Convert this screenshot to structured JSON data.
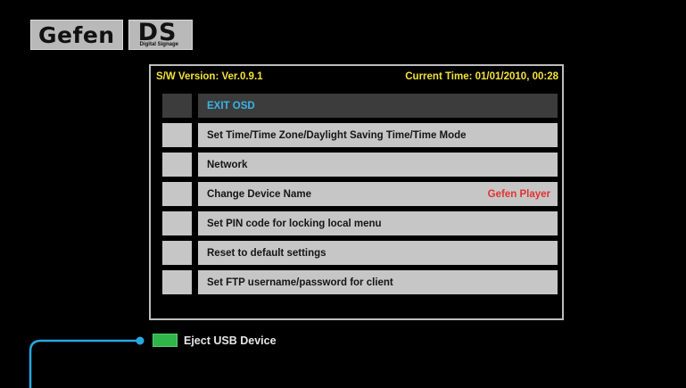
{
  "logo": {
    "brand": "Gefen",
    "product": "DS",
    "tagline": "Digital Signage"
  },
  "header": {
    "version": "S/W Version: Ver.0.9.1",
    "current_time": "Current Time: 01/01/2010, 00:28"
  },
  "menu": {
    "items": [
      {
        "label": "EXIT OSD",
        "value": "",
        "selected": true
      },
      {
        "label": "Set Time/Time Zone/Daylight Saving Time/Time Mode",
        "value": ""
      },
      {
        "label": "Network",
        "value": ""
      },
      {
        "label": "Change Device Name",
        "value": "Gefen Player"
      },
      {
        "label": "Set PIN code for locking local menu",
        "value": ""
      },
      {
        "label": "Reset to default settings",
        "value": ""
      },
      {
        "label": "Set FTP username/password for client",
        "value": ""
      }
    ]
  },
  "footer": {
    "eject_label": "Eject USB Device"
  },
  "colors": {
    "background": "#000000",
    "header_text": "#f2e23a",
    "selected_text": "#39b4e6",
    "value_text": "#e23232",
    "eject_button": "#2fb54a",
    "callout": "#29a8e0"
  }
}
